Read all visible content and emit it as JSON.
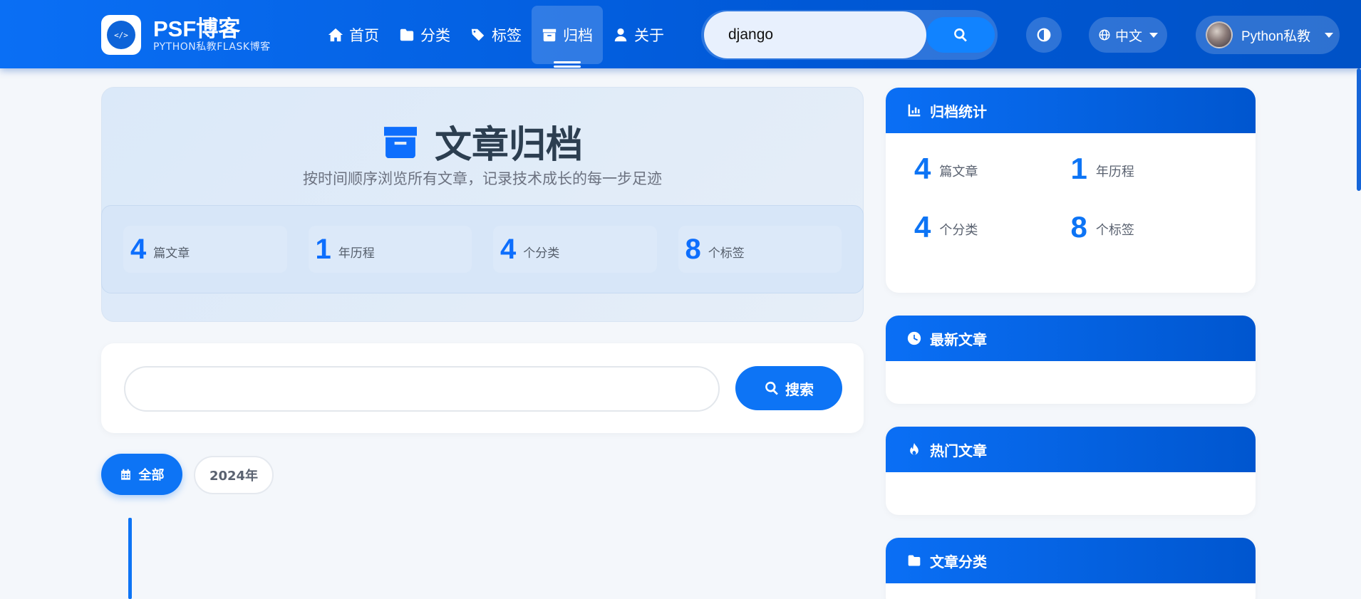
{
  "brand": {
    "title": "PSF博客",
    "subtitle": "PYTHON私教FLASK博客",
    "logo_text": "</>"
  },
  "nav": {
    "items": [
      {
        "label": "首页",
        "icon": "home-icon"
      },
      {
        "label": "分类",
        "icon": "folder-icon"
      },
      {
        "label": "标签",
        "icon": "tags-icon"
      },
      {
        "label": "归档",
        "icon": "archive-icon",
        "active": true
      },
      {
        "label": "关于",
        "icon": "user-icon"
      }
    ]
  },
  "search": {
    "value": "django"
  },
  "language": {
    "label": "中文"
  },
  "user": {
    "name": "Python私教"
  },
  "hero": {
    "title": "文章归档",
    "subtitle": "按时间顺序浏览所有文章，记录技术成长的每一步足迹",
    "stats": [
      {
        "num": "4",
        "label": "篇文章"
      },
      {
        "num": "1",
        "label": "年历程"
      },
      {
        "num": "4",
        "label": "个分类"
      },
      {
        "num": "8",
        "label": "个标签"
      }
    ]
  },
  "archive_search": {
    "button": "搜索",
    "placeholder": ""
  },
  "filters": {
    "all": "全部",
    "year": "2024年"
  },
  "sidebar": {
    "stats_title": "归档统计",
    "stats": [
      {
        "num": "4",
        "label": "篇文章"
      },
      {
        "num": "1",
        "label": "年历程"
      },
      {
        "num": "4",
        "label": "个分类"
      },
      {
        "num": "8",
        "label": "个标签"
      }
    ],
    "latest_title": "最新文章",
    "popular_title": "热门文章",
    "categories_title": "文章分类"
  },
  "colors": {
    "primary": "#0d74f5",
    "nav_gradient_start": "#0a6ff5",
    "nav_gradient_end": "#0052c6",
    "background": "#f4f7fb"
  }
}
